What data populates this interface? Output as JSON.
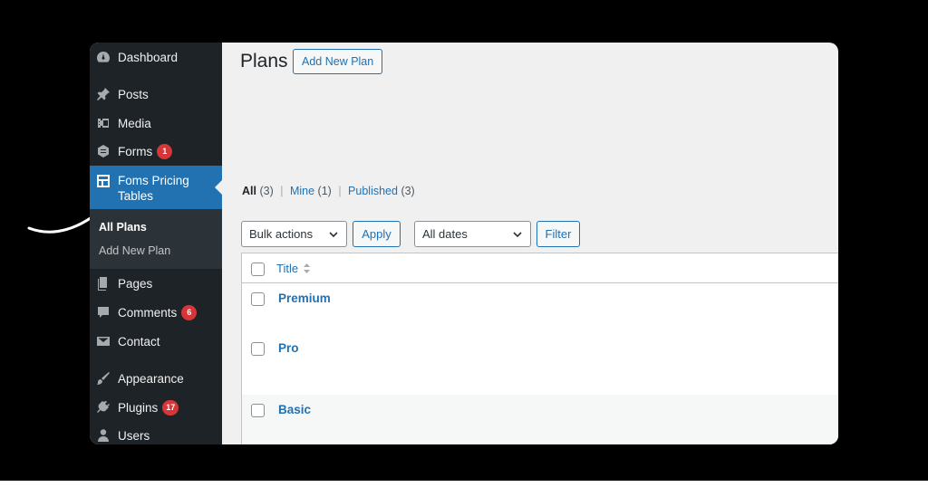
{
  "sidebar": {
    "items": [
      {
        "label": "Dashboard",
        "icon": "dashboard-icon"
      },
      {
        "label": "Posts",
        "icon": "pin-icon"
      },
      {
        "label": "Media",
        "icon": "media-icon"
      },
      {
        "label": "Forms",
        "icon": "forms-icon",
        "badge": "1"
      },
      {
        "label": "Foms Pricing Tables",
        "icon": "table-icon"
      },
      {
        "label": "Pages",
        "icon": "pages-icon"
      },
      {
        "label": "Comments",
        "icon": "comment-icon",
        "badge": "6"
      },
      {
        "label": "Contact",
        "icon": "mail-icon"
      },
      {
        "label": "Appearance",
        "icon": "paintbrush-icon"
      },
      {
        "label": "Plugins",
        "icon": "plugin-icon",
        "badge": "17"
      },
      {
        "label": "Users",
        "icon": "user-icon"
      }
    ],
    "submenu": {
      "all_plans": "All Plans",
      "add_new_plan": "Add New Plan"
    }
  },
  "header": {
    "title": "Plans",
    "add_new": "Add New Plan"
  },
  "views": {
    "all": "All",
    "all_count": "(3)",
    "mine": "Mine",
    "mine_count": "(1)",
    "published": "Published",
    "published_count": "(3)",
    "separator": "|"
  },
  "filters": {
    "bulk_actions": "Bulk actions",
    "apply": "Apply",
    "all_dates": "All dates",
    "filter": "Filter"
  },
  "table": {
    "column_title": "Title",
    "rows": [
      {
        "title": "Premium"
      },
      {
        "title": "Pro"
      },
      {
        "title": "Basic"
      }
    ]
  },
  "colors": {
    "accent": "#2271b1",
    "sidebar": "#1d2327",
    "badge": "#d63638"
  }
}
